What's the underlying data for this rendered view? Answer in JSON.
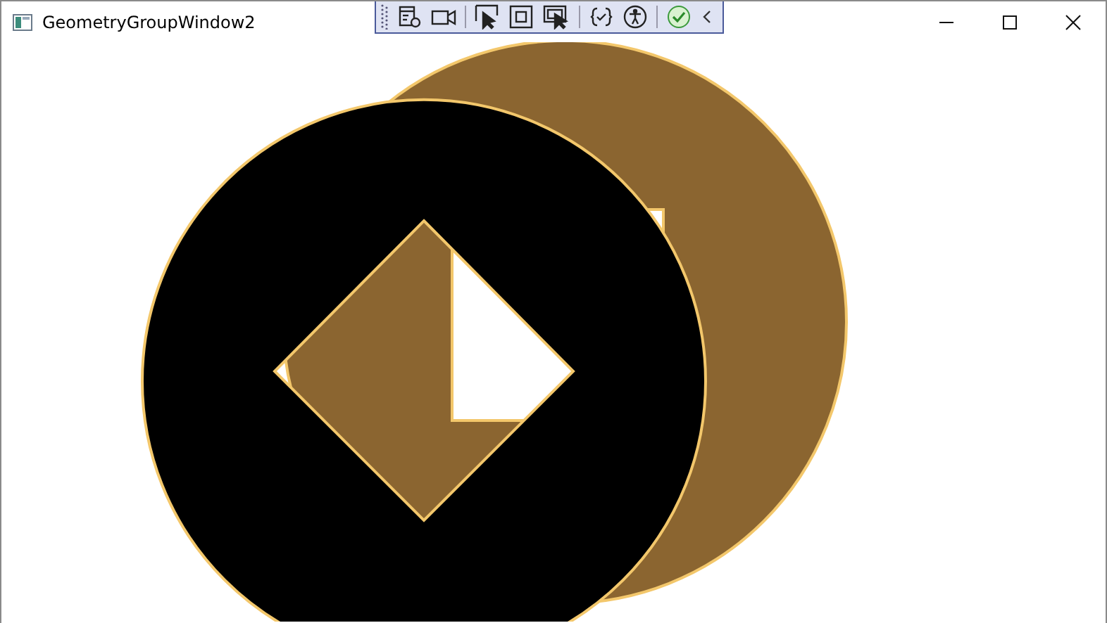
{
  "window": {
    "title": "GeometryGroupWindow2"
  }
}
